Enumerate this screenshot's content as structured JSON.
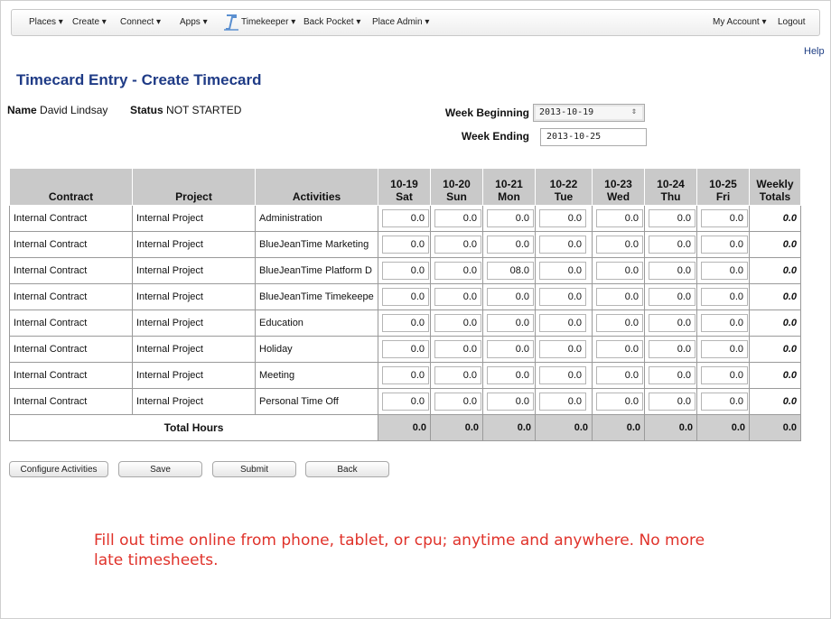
{
  "nav": {
    "places": "Places",
    "create": "Create",
    "connect": "Connect",
    "apps": "Apps",
    "timekeeper": "Timekeeper",
    "back_pocket": "Back Pocket",
    "place_admin": "Place Admin",
    "my_account": "My Account",
    "logout": "Logout"
  },
  "help": "Help",
  "page_title": "Timecard Entry - Create Timecard",
  "name_label": "Name",
  "name_value": "David Lindsay",
  "status_label": "Status",
  "status_value": "NOT STARTED",
  "week_beginning_label": "Week Beginning",
  "week_beginning_value": "2013-10-19",
  "week_ending_label": "Week Ending",
  "week_ending_value": "2013-10-25",
  "table": {
    "headers": {
      "contract": "Contract",
      "project": "Project",
      "activities": "Activities",
      "weekly_top": "Weekly",
      "weekly_bottom": "Totals"
    },
    "days": [
      {
        "date": "10-19",
        "day": "Sat"
      },
      {
        "date": "10-20",
        "day": "Sun"
      },
      {
        "date": "10-21",
        "day": "Mon"
      },
      {
        "date": "10-22",
        "day": "Tue"
      },
      {
        "date": "10-23",
        "day": "Wed"
      },
      {
        "date": "10-24",
        "day": "Thu"
      },
      {
        "date": "10-25",
        "day": "Fri"
      }
    ],
    "rows": [
      {
        "contract": "Internal Contract",
        "project": "Internal Project",
        "activity": "Administration",
        "hours": [
          "0.0",
          "0.0",
          "0.0",
          "0.0",
          "0.0",
          "0.0",
          "0.0"
        ],
        "total": "0.0"
      },
      {
        "contract": "Internal Contract",
        "project": "Internal Project",
        "activity": "BlueJeanTime Marketing",
        "hours": [
          "0.0",
          "0.0",
          "0.0",
          "0.0",
          "0.0",
          "0.0",
          "0.0"
        ],
        "total": "0.0"
      },
      {
        "contract": "Internal Contract",
        "project": "Internal Project",
        "activity": "BlueJeanTime Platform D",
        "hours": [
          "0.0",
          "0.0",
          "08.0",
          "0.0",
          "0.0",
          "0.0",
          "0.0"
        ],
        "total": "0.0"
      },
      {
        "contract": "Internal Contract",
        "project": "Internal Project",
        "activity": "BlueJeanTime Timekeepe",
        "hours": [
          "0.0",
          "0.0",
          "0.0",
          "0.0",
          "0.0",
          "0.0",
          "0.0"
        ],
        "total": "0.0"
      },
      {
        "contract": "Internal Contract",
        "project": "Internal Project",
        "activity": "Education",
        "hours": [
          "0.0",
          "0.0",
          "0.0",
          "0.0",
          "0.0",
          "0.0",
          "0.0"
        ],
        "total": "0.0"
      },
      {
        "contract": "Internal Contract",
        "project": "Internal Project",
        "activity": "Holiday",
        "hours": [
          "0.0",
          "0.0",
          "0.0",
          "0.0",
          "0.0",
          "0.0",
          "0.0"
        ],
        "total": "0.0"
      },
      {
        "contract": "Internal Contract",
        "project": "Internal Project",
        "activity": "Meeting",
        "hours": [
          "0.0",
          "0.0",
          "0.0",
          "0.0",
          "0.0",
          "0.0",
          "0.0"
        ],
        "total": "0.0"
      },
      {
        "contract": "Internal Contract",
        "project": "Internal Project",
        "activity": "Personal Time Off",
        "hours": [
          "0.0",
          "0.0",
          "0.0",
          "0.0",
          "0.0",
          "0.0",
          "0.0"
        ],
        "total": "0.0"
      }
    ],
    "total_label": "Total Hours",
    "totals": [
      "0.0",
      "0.0",
      "0.0",
      "0.0",
      "0.0",
      "0.0",
      "0.0"
    ],
    "grand_total": "0.0"
  },
  "buttons": {
    "configure": "Configure Activities",
    "save": "Save",
    "submit": "Submit",
    "back": "Back"
  },
  "promo_line1": "Fill out time online from phone, tablet, or cpu; anytime and anywhere.  No more",
  "promo_line2": "late timesheets.",
  "colors": {
    "title": "#1f3b86",
    "promo": "#e0322a",
    "header_bg": "#c9c9c9"
  }
}
